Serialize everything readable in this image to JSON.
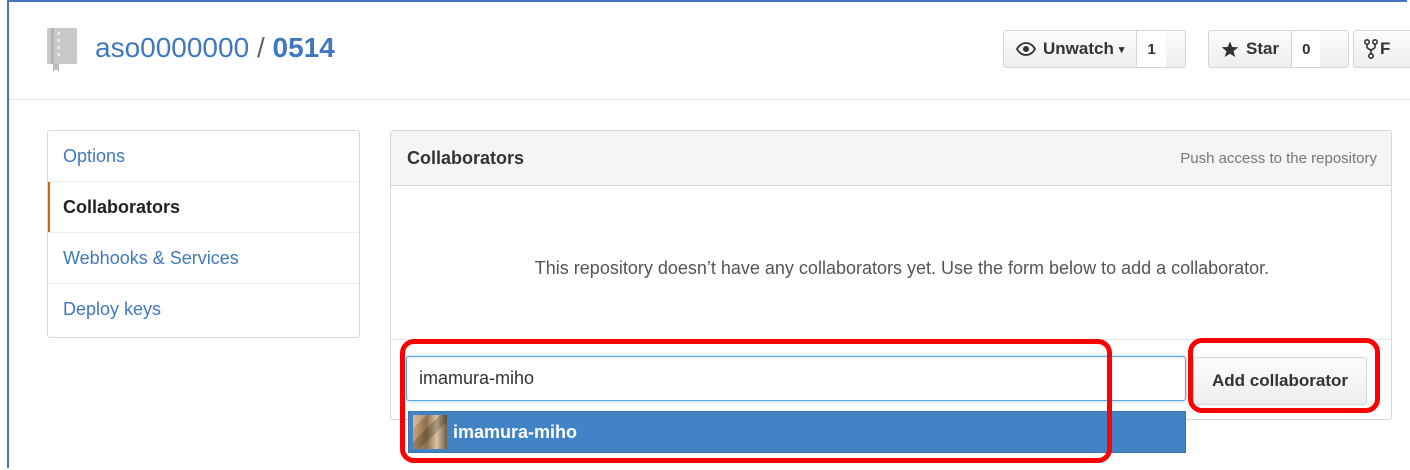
{
  "repo": {
    "owner": "aso0000000",
    "separator": "/",
    "name": "0514"
  },
  "actions": {
    "unwatch_label": "Unwatch",
    "unwatch_count": "1",
    "star_label": "Star",
    "star_count": "0",
    "fork_label": "F"
  },
  "sidebar": {
    "items": [
      {
        "label": "Options"
      },
      {
        "label": "Collaborators"
      },
      {
        "label": "Webhooks & Services"
      },
      {
        "label": "Deploy keys"
      }
    ]
  },
  "collaborators": {
    "title": "Collaborators",
    "note": "Push access to the repository",
    "blank_message": "This repository doesn’t have any collaborators yet. Use the form below to add a collaborator.",
    "input_value": "imamura-miho",
    "add_button_label": "Add collaborator",
    "suggestion_login": "imamura-miho"
  },
  "colors": {
    "link": "#4078c0",
    "selected_accent": "#d26911",
    "suggestion_bg": "#4183c4",
    "annotation": "#ff0000"
  }
}
